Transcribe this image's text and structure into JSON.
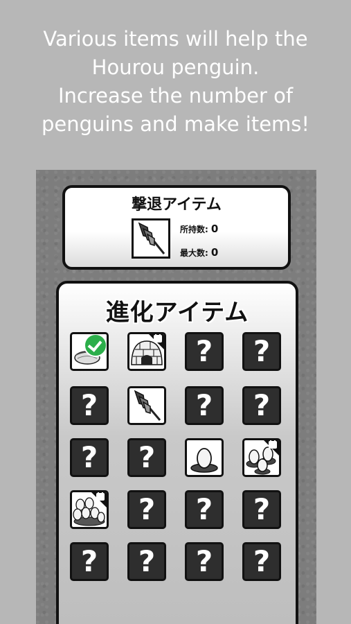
{
  "promo": {
    "text": "Various items will help the\nHourou penguin.\nIncrease the number of\npenguins and make items!"
  },
  "repel": {
    "title": "撃退アイテム",
    "item_icon": "spear-icon",
    "owned_label": "所持数:",
    "owned_value": "0",
    "max_label": "最大数:",
    "max_value": "0"
  },
  "evolution": {
    "title": "進化アイテム",
    "grid": [
      [
        {
          "kind": "item",
          "icon": "nest-icon",
          "status": "checked"
        },
        {
          "kind": "item",
          "icon": "igloo-icon",
          "status": "locked"
        },
        {
          "kind": "unknown",
          "label": "?"
        },
        {
          "kind": "unknown",
          "label": "?"
        }
      ],
      [
        {
          "kind": "unknown",
          "label": "?"
        },
        {
          "kind": "item",
          "icon": "spear-icon",
          "status": "unlocked"
        },
        {
          "kind": "unknown",
          "label": "?"
        },
        {
          "kind": "unknown",
          "label": "?"
        }
      ],
      [
        {
          "kind": "unknown",
          "label": "?"
        },
        {
          "kind": "unknown",
          "label": "?"
        },
        {
          "kind": "item",
          "icon": "egg-nest-icon",
          "status": "unlocked"
        },
        {
          "kind": "item",
          "icon": "three-eggs-icon",
          "status": "locked"
        }
      ],
      [
        {
          "kind": "item",
          "icon": "many-eggs-icon",
          "status": "locked"
        },
        {
          "kind": "unknown",
          "label": "?"
        },
        {
          "kind": "unknown",
          "label": "?"
        },
        {
          "kind": "unknown",
          "label": "?"
        }
      ],
      [
        {
          "kind": "unknown",
          "label": "?"
        },
        {
          "kind": "unknown",
          "label": "?"
        },
        {
          "kind": "unknown",
          "label": "?"
        },
        {
          "kind": "unknown",
          "label": "?"
        }
      ]
    ]
  },
  "colors": {
    "background": "#b7b7b7",
    "check": "#2cae4a",
    "tile_dark": "#2e2e2e"
  }
}
